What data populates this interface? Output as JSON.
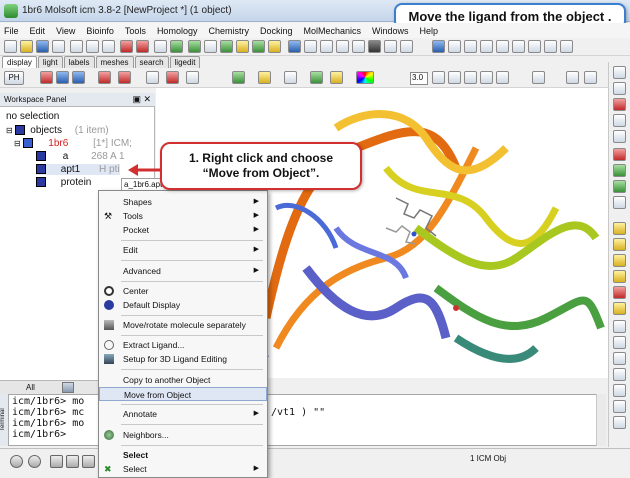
{
  "window": {
    "title": "1br6 Molsoft icm 3.8-2 [NewProject *] (1 object)"
  },
  "callout_top": {
    "text": "Move the ligand from the object ."
  },
  "callout_main": {
    "line1": "1. Right click and choose",
    "line2": "“Move from Object”."
  },
  "menubar": [
    "File",
    "Edit",
    "View",
    "Bioinfo",
    "Tools",
    "Homology",
    "Chemistry",
    "Docking",
    "MolMechanics",
    "Windows",
    "Help"
  ],
  "tabs": [
    "display",
    "light",
    "labels",
    "meshes",
    "search",
    "ligedit"
  ],
  "workspace": {
    "title": "Workspace Panel",
    "selection": "no selection",
    "tree": {
      "objects_label": "objects",
      "objects_count": "(1 item)",
      "obj_name": "1br6",
      "obj_meta": "[1*] ICM;",
      "mol_a_name": "a",
      "mol_a_count": "268 A",
      "mol_a_extra": "1",
      "apt1_name": "apt1",
      "apt1_meta": "H",
      "apt1_extra": "pti",
      "protein_name": "protein"
    }
  },
  "context_menu": {
    "title": "a_1br6.apt",
    "items": [
      {
        "label": "Shapes",
        "submenu": true
      },
      {
        "label": "Tools",
        "submenu": true
      },
      {
        "label": "Pocket",
        "submenu": true
      },
      {
        "label": "Edit",
        "submenu": true
      },
      {
        "label": "Advanced",
        "submenu": true
      },
      {
        "label": "Center",
        "submenu": false
      },
      {
        "label": "Default Display",
        "submenu": false
      },
      {
        "label": "Move/rotate molecule separately",
        "submenu": false
      },
      {
        "label": "Extract Ligand...",
        "submenu": false
      },
      {
        "label": "Setup for 3D Ligand Editing",
        "submenu": false
      },
      {
        "label": "Copy to another Object",
        "submenu": false
      },
      {
        "label": "Move from Object",
        "submenu": false
      },
      {
        "label": "Annotate",
        "submenu": true
      },
      {
        "label": "Neighbors...",
        "submenu": false
      },
      {
        "label": "Select",
        "submenu": false
      },
      {
        "label": "Select",
        "submenu": true
      }
    ]
  },
  "terminal": {
    "tab_all": "All",
    "label": "Terminal",
    "lines": [
      "icm/1br6> mo",
      "icm/1br6> mc",
      "icm/1br6> mo",
      "icm/1br6> "
    ],
    "right_text": "/vt1 ) \"\""
  },
  "toolbar": {
    "zoom_value": "3.0"
  },
  "status": {
    "objects": "1 ICM Obj"
  }
}
